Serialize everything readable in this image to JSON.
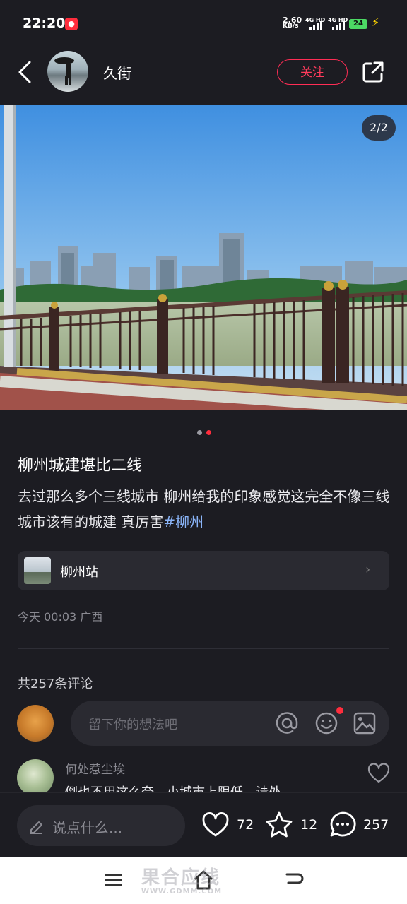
{
  "status_bar": {
    "time": "22:20",
    "network_speed": "2.60",
    "network_unit": "KB/s",
    "sim1": "4G HD",
    "sim2": "4G HD",
    "battery": "24"
  },
  "header": {
    "username": "久街",
    "follow_label": "关注"
  },
  "post": {
    "image_counter": "2/2",
    "title": "柳州城建堪比二线",
    "body": "去过那么多个三线城市 柳州给我的印象感觉这完全不像三线城市该有的城建 真厉害",
    "hashtag": "#柳州",
    "location": "柳州站",
    "meta": "今天 00:03 广西"
  },
  "comments": {
    "total": "共257条评论",
    "input_placeholder": "留下你的想法吧",
    "items": [
      {
        "author": "何处惹尘埃",
        "text": "倒也不用这么夸，小城市上限低，请处"
      }
    ]
  },
  "action_bar": {
    "say_placeholder": "说点什么...",
    "likes": "72",
    "favorites": "12",
    "comments": "257"
  },
  "watermark": {
    "text": "果合应线",
    "url": "WWW.GDMM.COM"
  },
  "colors": {
    "accent": "#ff2d55",
    "hashtag": "#8ab4f8",
    "background": "#1c1c22"
  }
}
